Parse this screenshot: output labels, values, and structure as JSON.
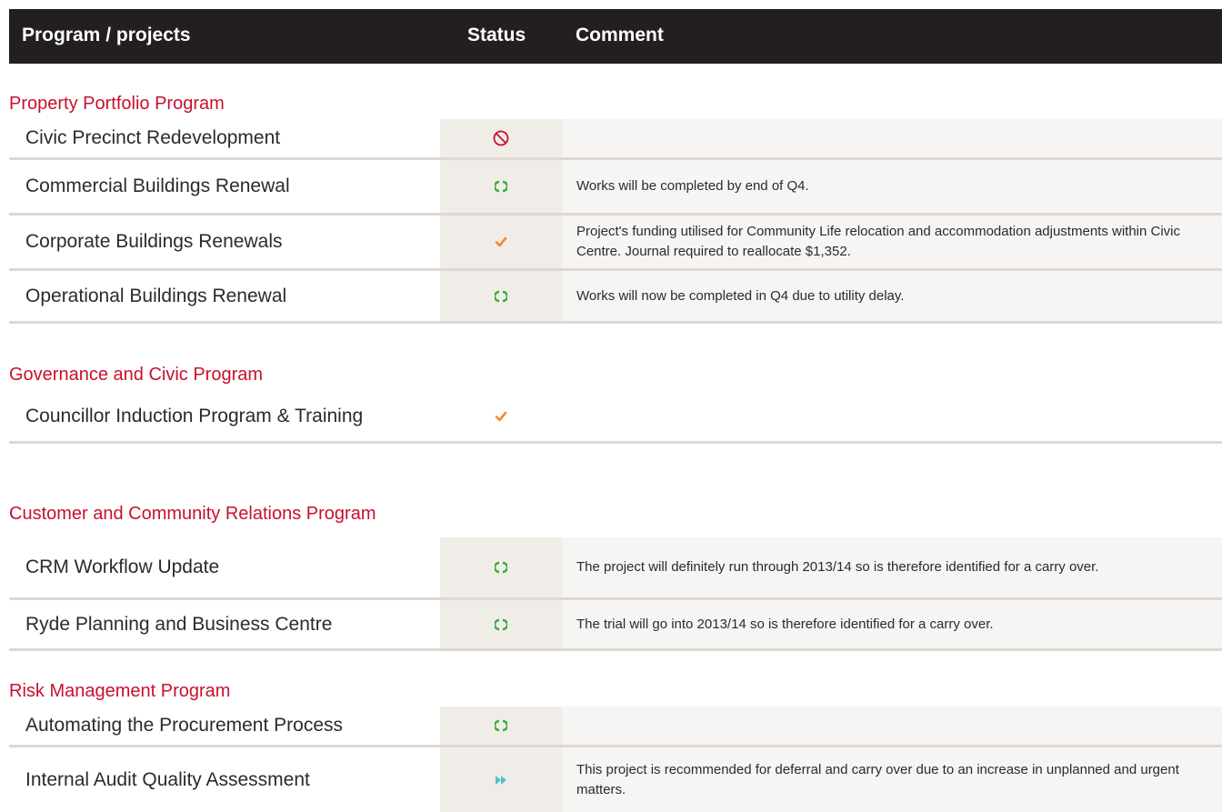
{
  "header": {
    "project_label": "Program / projects",
    "status_label": "Status",
    "comment_label": "Comment"
  },
  "icon_legend": {
    "not_started": "prohibit-icon",
    "in_progress": "cycle-arrows-icon",
    "completed": "checkmark-icon",
    "deferred": "fast-forward-icon"
  },
  "colors": {
    "header_bg": "#231f20",
    "section_title": "#c8102e",
    "in_progress": "#3aaa35",
    "completed": "#f28c28",
    "deferred": "#4fc3c8",
    "not_started": "#c8102e"
  },
  "sections": [
    {
      "title": "Property Portfolio Program",
      "rows": [
        {
          "project": "Civic Precinct Redevelopment",
          "status": "not_started",
          "comment": ""
        },
        {
          "project": "Commercial Buildings Renewal",
          "status": "in_progress",
          "comment": "Works will be completed by end of Q4."
        },
        {
          "project": "Corporate Buildings Renewals",
          "status": "completed",
          "comment": "Project's funding utilised for Community Life relocation and accommodation adjustments within Civic Centre. Journal required to reallocate $1,352."
        },
        {
          "project": "Operational Buildings Renewal",
          "status": "in_progress",
          "comment": "Works will now be completed in Q4 due to utility delay."
        }
      ]
    },
    {
      "title": "Governance and Civic Program",
      "rows": [
        {
          "project": "Councillor Induction Program & Training",
          "status": "completed",
          "comment": ""
        }
      ]
    },
    {
      "title": "Customer and Community Relations Program",
      "rows": [
        {
          "project": "CRM Workflow Update",
          "status": "in_progress",
          "comment": "The project will definitely run through 2013/14 so is therefore identified for a carry over."
        },
        {
          "project": "Ryde Planning and Business Centre",
          "status": "in_progress",
          "comment": "The trial will go into 2013/14 so is therefore identified for a carry over."
        }
      ]
    },
    {
      "title": "Risk Management Program",
      "rows": [
        {
          "project": "Automating the Procurement Process",
          "status": "in_progress",
          "comment": ""
        },
        {
          "project": "Internal Audit Quality Assessment",
          "status": "deferred",
          "comment": "This project is recommended for deferral and carry over due to an increase in unplanned and urgent matters."
        }
      ]
    }
  ]
}
